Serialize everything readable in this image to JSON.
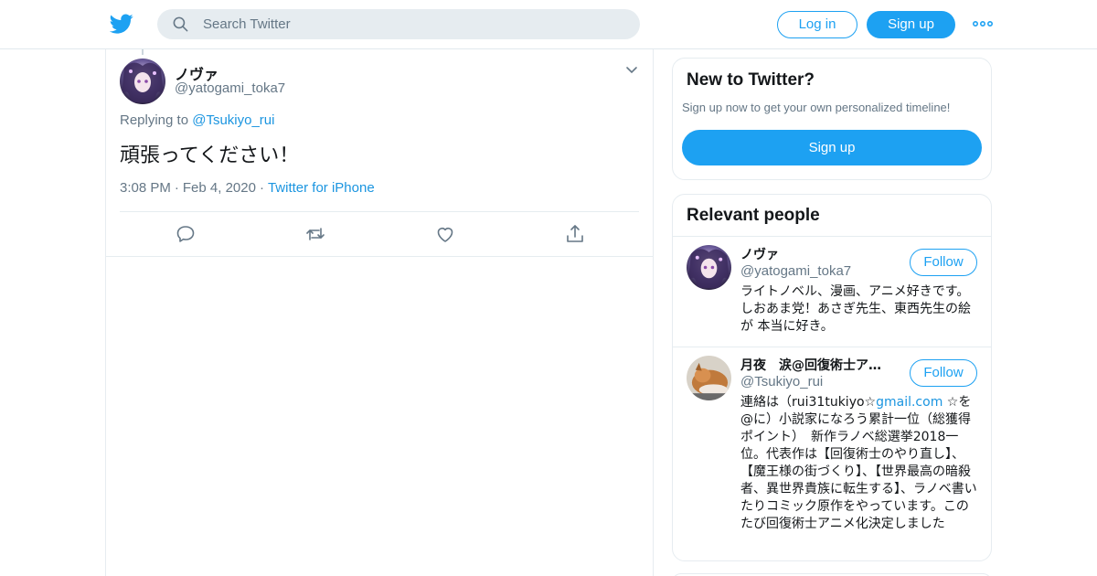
{
  "header": {
    "search_placeholder": "Search Twitter",
    "login_label": "Log in",
    "signup_label": "Sign up"
  },
  "tweet": {
    "author_name": "ノヴァ",
    "author_handle": "@yatogami_toka7",
    "replying_prefix": "Replying to",
    "replying_to": "@Tsukiyo_rui",
    "text": "頑張ってください！",
    "time": "3:08 PM",
    "date": "Feb 4, 2020",
    "separator": "·",
    "source": "Twitter for iPhone"
  },
  "sidebar": {
    "new_to_twitter": {
      "title": "New to Twitter?",
      "subtitle": "Sign up now to get your own personalized timeline!",
      "signup_label": "Sign up"
    },
    "relevant_people": {
      "title": "Relevant people",
      "people": [
        {
          "name": "ノヴァ",
          "handle": "@yatogami_toka7",
          "follow_label": "Follow",
          "bio": "ライトノベル、漫画、アニメ好きです。しおあま党！あさぎ先生、東西先生の絵が 本当に好き。"
        },
        {
          "name": "月夜　涙@回復術士ア…",
          "handle": "@Tsukiyo_rui",
          "follow_label": "Follow",
          "bio_prefix": "連絡は（rui31tukiyo☆",
          "bio_link": "gmail.com",
          "bio_suffix": " ☆を@に）小説家になろう累計一位（総獲得ポイント）　新作ラノベ総選挙2018一位。代表作は【回復術士のやり直し】、【魔王様の街づくり】、【世界最高の暗殺者、異世界貴族に転生する】、ラノベ書いたりコミック原作をやっています。このたび回復術士アニメ化決定しました"
        }
      ]
    }
  },
  "colors": {
    "brand_blue": "#1da1f2",
    "link_blue": "#1b95e0",
    "secondary_text": "#657786",
    "border": "#e6ecf0"
  },
  "icons": [
    "twitter-bird-icon",
    "search-icon",
    "more-icon",
    "chevron-down-icon",
    "reply-icon",
    "retweet-icon",
    "like-icon",
    "share-icon"
  ]
}
